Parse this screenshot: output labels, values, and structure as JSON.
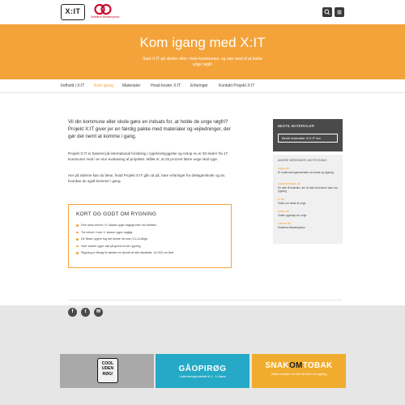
{
  "header": {
    "logo_text": "X:IT",
    "partner_logo_text": "Kræftens Bekæmpelse",
    "search_icon": "search-icon",
    "menu_icon": "hamburger-menu-icon"
  },
  "hero": {
    "title": "Kom igang med X:IT",
    "subtitle": "Start X:IT på skolen eller i hele kommunen, og vær med til at holde unge røgfri"
  },
  "nav": {
    "items": [
      "Indhold i X:IT",
      "Kom igang",
      "Materialer",
      "Hvad koster X:IT",
      "Erfaringer",
      "Kontakt Projekt X:IT"
    ],
    "active": "Kom igang"
  },
  "main": {
    "intro": "Vil din kommune eller skole gøre en indsats for, at holde de unge røgfri? Projekt X:IT giver jer en færdig pakke med materialer og vejledninger, der gør det nemt at komme i gang.",
    "p1": "Projekt X:IT er baseret på international forskning i rygeforebyggelse og netop nu er 93 skoler fra 17 kommuner med i en stor evaluering af projektet. Målet er, at 25 procent færre unge skal ryge.",
    "p2": "Her på siderne kan du læse, hvad Projekt X:IT går ud på, høre erfaringer fra deltagerskoler og se, hvordan du også kommer i gang."
  },
  "factbox": {
    "title": "KORT OG GODT OM RYGNING",
    "items": [
      "Fem seks elever i 9. klasse ryger dagligt eller ind imellem",
      "Tre elever i hver 9. klasse ryger dagligt",
      "De fleste rygere tog det første hiv som 13-14-årige",
      "Hver anden ryger dør på grund af sin rygning",
      "Rygning er årsag til næsten en fjerdel af alle dødsfald, 14.000 om året"
    ]
  },
  "sidebar": {
    "order_title": "BESTIL MATERIALER",
    "order_button": "Bestil materialer til X:IT her",
    "links_title": "ANDRE WEBSIDER OM RYGNING",
    "links": [
      {
        "url": "cigna.dk",
        "desc": "Et undervisningsmateriale om tobak og rygning"
      },
      {
        "url": "snakomtobak.dk",
        "desc": "En side til forældre, der vil tale med deres barn om rygning"
      },
      {
        "url": "tv.dk",
        "desc": "Viden om tobak til unge"
      },
      {
        "url": "xhale.dk",
        "desc": "Gratis rygestop for unge"
      },
      {
        "url": "cancer.dk",
        "desc": "Kræftens Bekæmpelse"
      }
    ]
  },
  "share": {
    "buttons": [
      "f",
      "t",
      "✉"
    ]
  },
  "banners": {
    "cool": [
      "COOL",
      "UDEN",
      "RØG!"
    ],
    "gaa_title": "GÅOPIRØG",
    "gaa_sub": "Undervisningsmateriale til 4. - 6. klasse",
    "snak_pre": "SNAK",
    "snak_om": "OM",
    "snak_post": "TOBAK",
    "snak_sub": "Sådan snakker du med dit barn om rygning"
  }
}
